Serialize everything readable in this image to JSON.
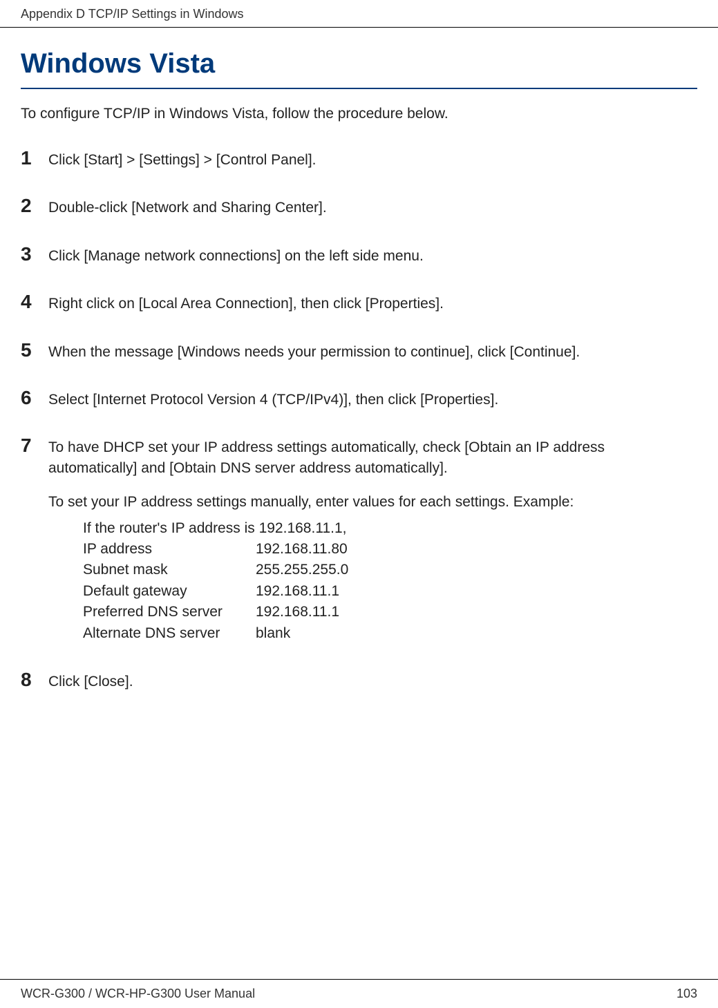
{
  "header": {
    "text": "Appendix D  TCP/IP Settings in Windows"
  },
  "section": {
    "title": "Windows Vista",
    "intro": "To configure TCP/IP in Windows Vista, follow the procedure below."
  },
  "steps": [
    {
      "num": "1",
      "text": "Click [Start] > [Settings] > [Control Panel]."
    },
    {
      "num": "2",
      "text": "Double-click [Network and Sharing Center]."
    },
    {
      "num": "3",
      "text": "Click [Manage network connections] on the left side menu."
    },
    {
      "num": "4",
      "text": "Right click on [Local Area Connection], then click [Properties]."
    },
    {
      "num": "5",
      "text": "When the message [Windows needs your permission to continue], click [Continue]."
    },
    {
      "num": "6",
      "text": "Select [Internet Protocol Version 4 (TCP/IPv4)], then click [Properties]."
    }
  ],
  "step7": {
    "num": "7",
    "text1": "To have DHCP set your IP address settings automatically, check [Obtain an IP address automatically] and [Obtain DNS server address automatically].",
    "text2": "To set your IP address settings manually, enter values for each settings.  Example:",
    "example": {
      "intro": "If the router's IP address is 192.168.11.1,",
      "rows": [
        {
          "label": "IP address",
          "value": "192.168.11.80"
        },
        {
          "label": "Subnet mask",
          "value": "255.255.255.0"
        },
        {
          "label": "Default gateway",
          "value": "192.168.11.1"
        },
        {
          "label": "Preferred DNS server",
          "value": "192.168.11.1"
        },
        {
          "label": "Alternate DNS server",
          "value": "blank"
        }
      ]
    }
  },
  "step8": {
    "num": "8",
    "text": "Click [Close]."
  },
  "footer": {
    "left": "WCR-G300 / WCR-HP-G300 User Manual",
    "right": "103"
  }
}
